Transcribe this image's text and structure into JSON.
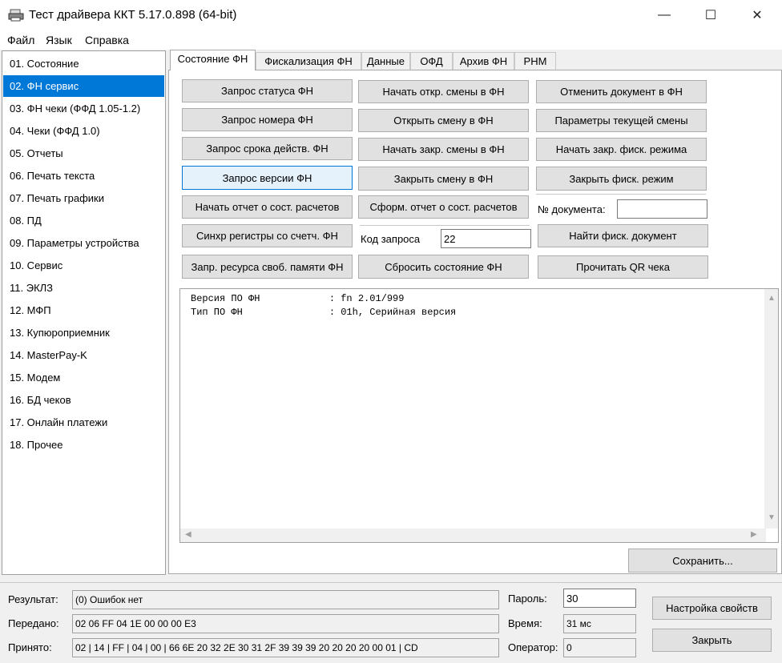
{
  "window": {
    "title": "Тест драйвера ККТ 5.17.0.898 (64-bit)",
    "minimize_glyph": "—",
    "maximize_glyph": "☐",
    "close_glyph": "✕",
    "icon": "printer-icon"
  },
  "menu": [
    "Файл",
    "Язык",
    "Справка"
  ],
  "sidebar": {
    "items": [
      "01. Состояние",
      "02. ФН сервис",
      "03. ФН чеки (ФФД 1.05-1.2)",
      "04. Чеки (ФФД 1.0)",
      "05. Отчеты",
      "06. Печать текста",
      "07. Печать графики",
      "08. ПД",
      "09. Параметры устройства",
      "10. Сервис",
      "11. ЭКЛЗ",
      "12. МФП",
      "13. Купюроприемник",
      "14. MasterPay-K",
      "15. Модем",
      "16. БД чеков",
      "17. Онлайн платежи",
      "18. Прочее"
    ],
    "selected_index": 1,
    "selected_color": "#0078d7"
  },
  "tabs": {
    "items": [
      "Состояние ФН",
      "Фискализация ФН",
      "Данные",
      "ОФД",
      "Архив ФН",
      "РНМ"
    ],
    "active_index": 0
  },
  "buttons": {
    "col1": [
      "Запрос статуса ФН",
      "Запрос номера ФН",
      "Запрос срока действ. ФН",
      "Запрос версии ФН",
      "Начать отчет о сост. расчетов",
      "Синхр регистры со счетч. ФН",
      "Запр. ресурса своб. памяти ФН"
    ],
    "col2": [
      "Начать откр. смены в ФН",
      "Открыть смену в ФН",
      "Начать закр. смены в ФН",
      "Закрыть смену в ФН",
      "Сформ. отчет о сост. расчетов",
      "Сбросить состояние ФН"
    ],
    "col3": [
      "Отменить документ в ФН",
      "Параметры текущей смены",
      "Начать закр. фиск. режима",
      "Закрыть фиск. режим",
      "Найти фиск. документ",
      "Прочитать QR чека"
    ],
    "save": "Сохранить...",
    "settings": "Настройка свойств",
    "close": "Закрыть",
    "focused_accent": "#0078d7"
  },
  "fields": {
    "doc_number_label": "№ документа:",
    "doc_number_value": "",
    "request_code_label": "Код запроса",
    "request_code_value": "22"
  },
  "output": {
    "text": "Версия ПО ФН            : fn 2.01/999\nТип ПО ФН               : 01h, Серийная версия"
  },
  "status": {
    "result_label": "Результат:",
    "result_value": "(0) Ошибок нет",
    "sent_label": "Передано:",
    "sent_value": "02 06 FF 04 1E 00 00 00 E3",
    "received_label": "Принято:",
    "received_value": "02 | 14 | FF | 04 | 00 | 66 6E 20 32 2E 30 31 2F 39 39 39 20 20 20 20 00 01 | CD",
    "password_label": "Пароль:",
    "password_value": "30",
    "time_label": "Время:",
    "time_value": "31 мс",
    "operator_label": "Оператор:",
    "operator_value": "0"
  }
}
